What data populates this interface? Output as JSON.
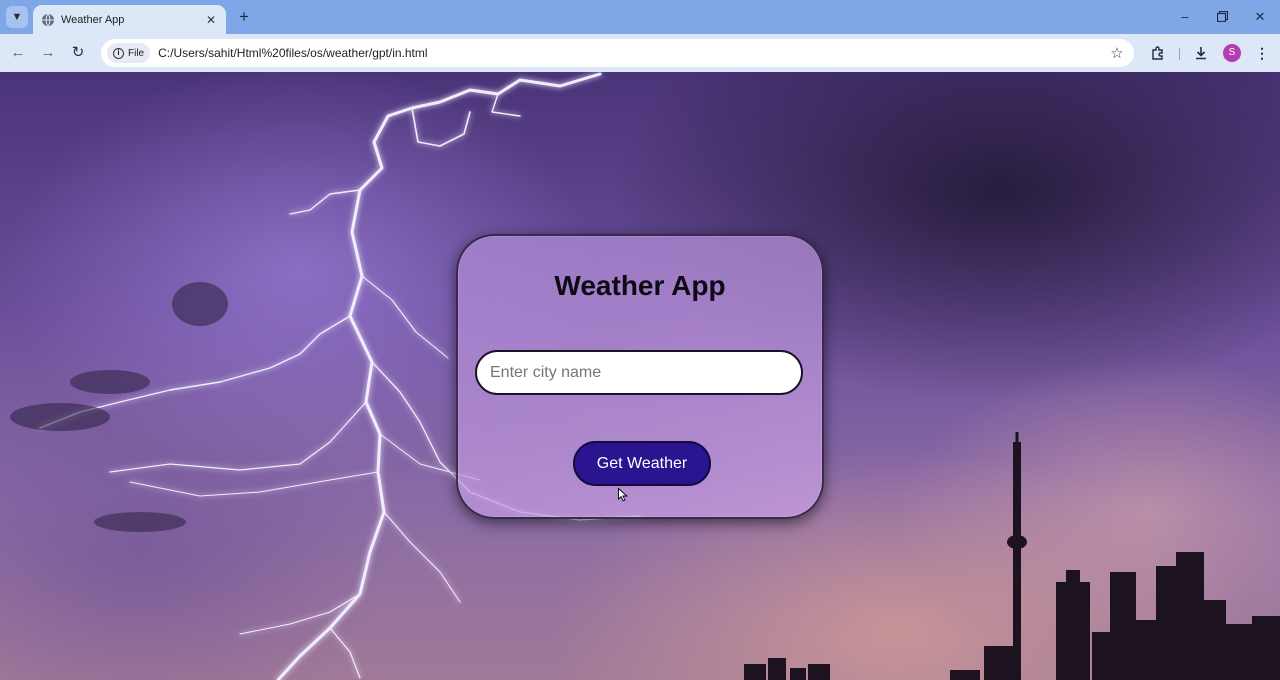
{
  "browser": {
    "tab_title": "Weather App",
    "url_chip": "File",
    "url": "C:/Users/sahit/Html%20files/os/weather/gpt/in.html",
    "profile_initial": "S"
  },
  "icons": {
    "tab_menu": "chevron-down-icon",
    "favicon": "globe-icon",
    "tab_close": "close-icon",
    "new_tab": "plus-icon",
    "minimize": "minimize-icon",
    "restore": "restore-icon",
    "close_window": "close-icon",
    "back": "arrow-left-icon",
    "forward": "arrow-right-icon",
    "reload": "reload-icon",
    "info": "info-icon",
    "bookmark": "star-icon",
    "extensions": "puzzle-icon",
    "downloads": "download-icon",
    "menu": "more-vertical-icon"
  },
  "app": {
    "title": "Weather App",
    "input_placeholder": "Enter city name",
    "input_value": "",
    "button_label": "Get Weather"
  },
  "colors": {
    "tabstrip": "#7fa7e8",
    "toolbar": "#dce7f8",
    "button": "#2b1490",
    "profile": "#b23db5"
  }
}
